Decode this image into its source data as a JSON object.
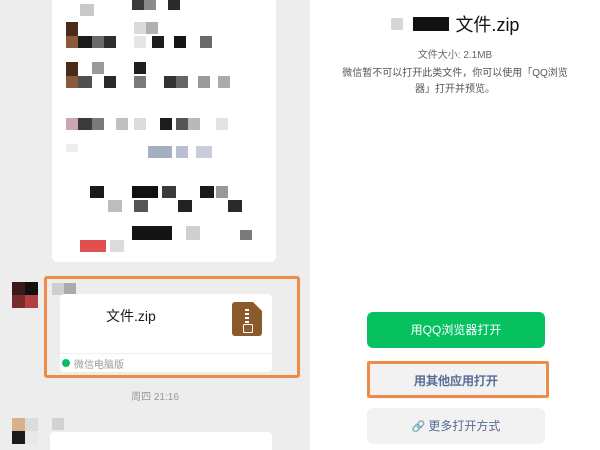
{
  "chat": {
    "file_name": "文件.zip",
    "source": "微信电脑版",
    "timestamp": "周四 21:16",
    "zip_icon": "zip-file-icon",
    "wechat_icon": "wechat-icon"
  },
  "preview": {
    "file_name": "文件.zip",
    "file_size": "文件大小: 2.1MB",
    "message": "微信暂不可以打开此类文件，你可以使用「QQ浏览器」打开并预览。",
    "open_qq_label": "用QQ浏览器打开",
    "open_other_label": "用其他应用打开",
    "more_ways_label": "更多打开方式",
    "link_icon": "link-icon"
  },
  "colors": {
    "primary_green": "#07c160",
    "link_blue": "#576b95",
    "highlight_orange": "#f08a4b"
  }
}
